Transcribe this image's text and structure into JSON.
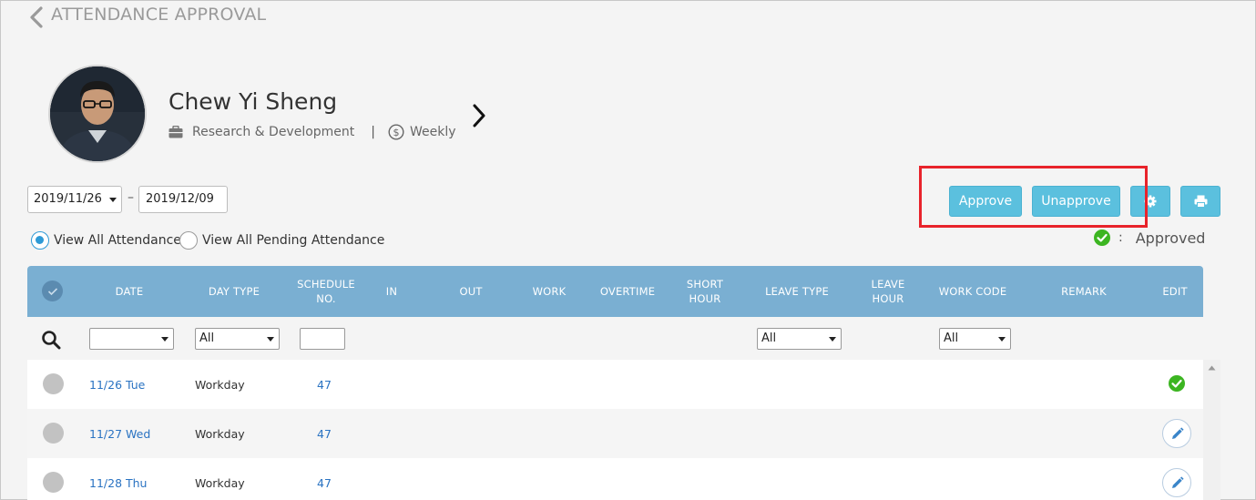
{
  "header": {
    "title": "ATTENDANCE APPROVAL"
  },
  "employee": {
    "name": "Chew Yi Sheng",
    "department": "Research & Development",
    "separator": "|",
    "pay_cycle": "Weekly"
  },
  "date_range": {
    "from": "2019/11/26",
    "dash": "–",
    "to": "2019/12/09"
  },
  "view_filter": {
    "options": [
      {
        "label": "View All Attendance",
        "checked": true
      },
      {
        "label": "View All Pending Attendance",
        "checked": false
      }
    ]
  },
  "toolbar": {
    "approve_label": "Approve",
    "unapprove_label": "Unapprove",
    "settings_icon": "gear-icon",
    "print_icon": "print-icon"
  },
  "legend": {
    "colon": ":",
    "approved_label": "Approved",
    "approved_color": "#3cb521"
  },
  "table": {
    "columns": [
      "DATE",
      "DAY TYPE",
      "SCHEDULE NO.",
      "IN",
      "OUT",
      "WORK",
      "OVERTIME",
      "SHORT HOUR",
      "LEAVE TYPE",
      "LEAVE HOUR",
      "WORK CODE",
      "REMARK",
      "EDIT"
    ],
    "filters": {
      "date": "",
      "day_type": "All",
      "schedule_no": "",
      "leave_type": "All",
      "work_code": "All"
    },
    "rows": [
      {
        "date": "11/26 Tue",
        "day_type": "Workday",
        "schedule_no": "47",
        "status": "approved"
      },
      {
        "date": "11/27 Wed",
        "day_type": "Workday",
        "schedule_no": "47",
        "status": "editable"
      },
      {
        "date": "11/28 Thu",
        "day_type": "Workday",
        "schedule_no": "47",
        "status": "editable"
      }
    ]
  },
  "colors": {
    "header_bg": "#7aafd2",
    "button_bg": "#5bc0de",
    "link": "#2a73c2",
    "highlight": "#e8232b"
  }
}
